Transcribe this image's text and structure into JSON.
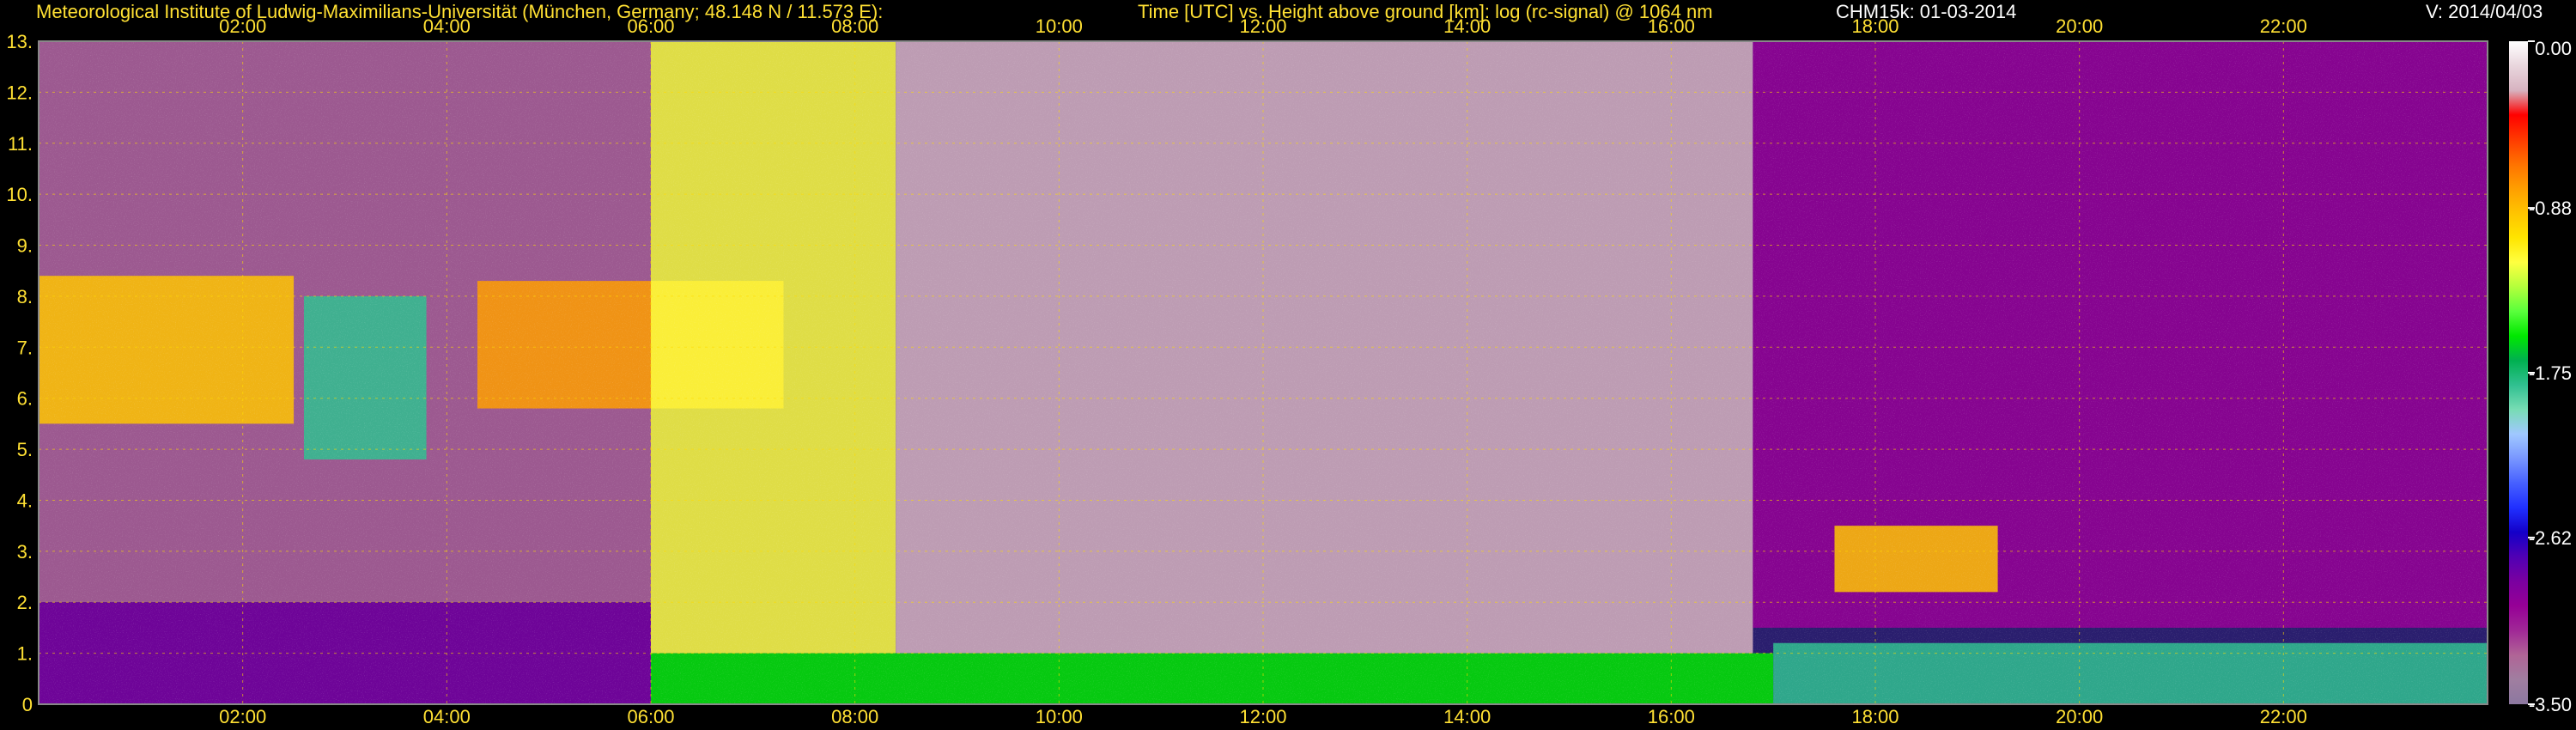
{
  "header": {
    "institute": "Meteorological Institute of Ludwig-Maximilians-Universität (München, Germany; 48.148 N / 11.573 E):",
    "description": "Time [UTC] vs. Height above ground [km]: log (rc-signal) @ 1064 nm",
    "instrument": "CHM15k: 01-03-2014",
    "version": "V: 2014/04/03"
  },
  "colors": {
    "text_yellow": "#ffe033",
    "text_white": "#ffffff",
    "grid": "#ffdc00",
    "background": "#000000"
  },
  "chart_data": {
    "type": "heatmap",
    "xlabel": "",
    "ylabel": "",
    "xlim": [
      0.0,
      24.0
    ],
    "ylim": [
      0,
      13
    ],
    "x_ticks": [
      "02:00",
      "04:00",
      "06:00",
      "08:00",
      "10:00",
      "12:00",
      "14:00",
      "16:00",
      "18:00",
      "20:00",
      "22:00"
    ],
    "y_ticks": [
      "0",
      "1.",
      "2.",
      "3.",
      "4.",
      "5.",
      "6.",
      "7.",
      "8.",
      "9.",
      "10.",
      "11.",
      "12.",
      "13."
    ],
    "grid": true,
    "colorbar": {
      "range": [
        -3.5,
        0.0
      ],
      "tick_labels": [
        "0.00",
        "-0.88",
        "-1.75",
        "-2.62",
        "-3.50"
      ],
      "tick_values": [
        0.0,
        -0.88,
        -1.75,
        -2.62,
        -3.5
      ],
      "colors": [
        "#ffffff",
        "#e9d6dd",
        "#d7b3c0",
        "#ff0000",
        "#ff3a00",
        "#ff7200",
        "#ff9e00",
        "#ffc400",
        "#ffe400",
        "#ffff40",
        "#b4ff3c",
        "#5aff3c",
        "#00e800",
        "#00b050",
        "#30c090",
        "#78dcb4",
        "#a0c8ff",
        "#7896ff",
        "#4660ff",
        "#2030ff",
        "#1400c8",
        "#5000b4",
        "#7a00a0",
        "#960096",
        "#a02896",
        "#b06496",
        "#a07ea0",
        "#8c78a0"
      ]
    },
    "regions": [
      {
        "feature": "background_noise",
        "t_start": 0.0,
        "t_end": 6.0,
        "h_start": 2.0,
        "h_end": 13.0,
        "log_signal": -3.2
      },
      {
        "feature": "boundary_layer",
        "t_start": 0.0,
        "t_end": 6.0,
        "h_start": 0.0,
        "h_end": 2.0,
        "log_signal": -2.9
      },
      {
        "feature": "cirrus",
        "t_start": 0.0,
        "t_end": 2.5,
        "h_start": 5.5,
        "h_end": 8.4,
        "log_signal": -0.9
      },
      {
        "feature": "cirrus",
        "t_start": 2.6,
        "t_end": 3.8,
        "h_start": 4.8,
        "h_end": 8.0,
        "log_signal": -1.8
      },
      {
        "feature": "cirrus",
        "t_start": 4.3,
        "t_end": 7.3,
        "h_start": 5.8,
        "h_end": 8.3,
        "log_signal": -0.8
      },
      {
        "feature": "daylight_noise",
        "t_start": 6.0,
        "t_end": 8.4,
        "h_start": 1.0,
        "h_end": 13.0,
        "log_signal": -1.2
      },
      {
        "feature": "daylight_noise",
        "t_start": 8.4,
        "t_end": 16.8,
        "h_start": 1.0,
        "h_end": 13.0,
        "log_signal": -0.3
      },
      {
        "feature": "background_noise",
        "t_start": 16.8,
        "t_end": 24.0,
        "h_start": 1.5,
        "h_end": 13.0,
        "log_signal": -3.0
      },
      {
        "feature": "aerosol_layer",
        "t_start": 6.0,
        "t_end": 17.0,
        "h_start": 0.0,
        "h_end": 1.0,
        "log_signal": -1.5
      },
      {
        "feature": "aerosol_layer",
        "t_start": 17.0,
        "t_end": 24.0,
        "h_start": 0.0,
        "h_end": 1.2,
        "log_signal": -1.8
      },
      {
        "feature": "low_cloud",
        "t_start": 17.6,
        "t_end": 19.2,
        "h_start": 2.2,
        "h_end": 3.5,
        "log_signal": -0.9
      }
    ]
  }
}
